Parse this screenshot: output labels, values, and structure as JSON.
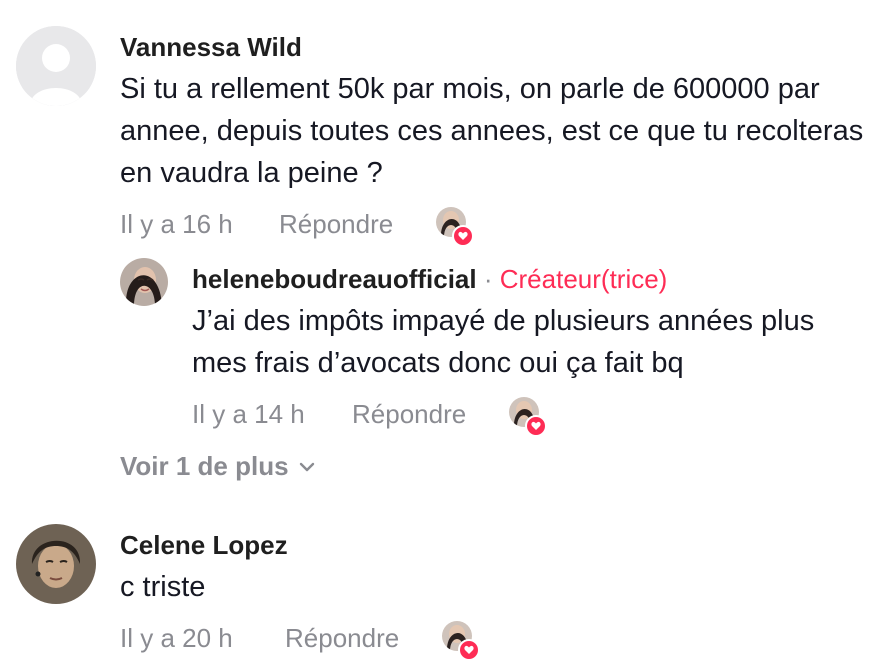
{
  "comments": [
    {
      "author": "Vannessa Wild",
      "text": "Si tu a rellement 50k par mois, on parle de 600000 par annee, depuis toutes ces annees, est ce que tu recolteras en vaudra la peine ?",
      "time": "Il y a 16 h",
      "reply_label": "Répondre",
      "avatar_icon": "default-user-avatar"
    },
    {
      "author": "heleneboudreauofficial",
      "separator": "·",
      "creator_tag": "Créateur(trice)",
      "text": "J’ai des impôts impayé de plusieurs années plus mes frais d’avocats donc oui ça fait bq",
      "time": "Il y a 14 h",
      "reply_label": "Répondre"
    },
    {
      "author": "Celene Lopez",
      "text": "c triste",
      "time": "Il y a 20 h",
      "reply_label": "Répondre"
    }
  ],
  "view_more": {
    "label": "Voir 1 de plus",
    "icon": "chevron-down-icon"
  },
  "colors": {
    "accent": "#fe2c55",
    "secondary_text": "#8a8b91",
    "primary_text": "#161823"
  }
}
